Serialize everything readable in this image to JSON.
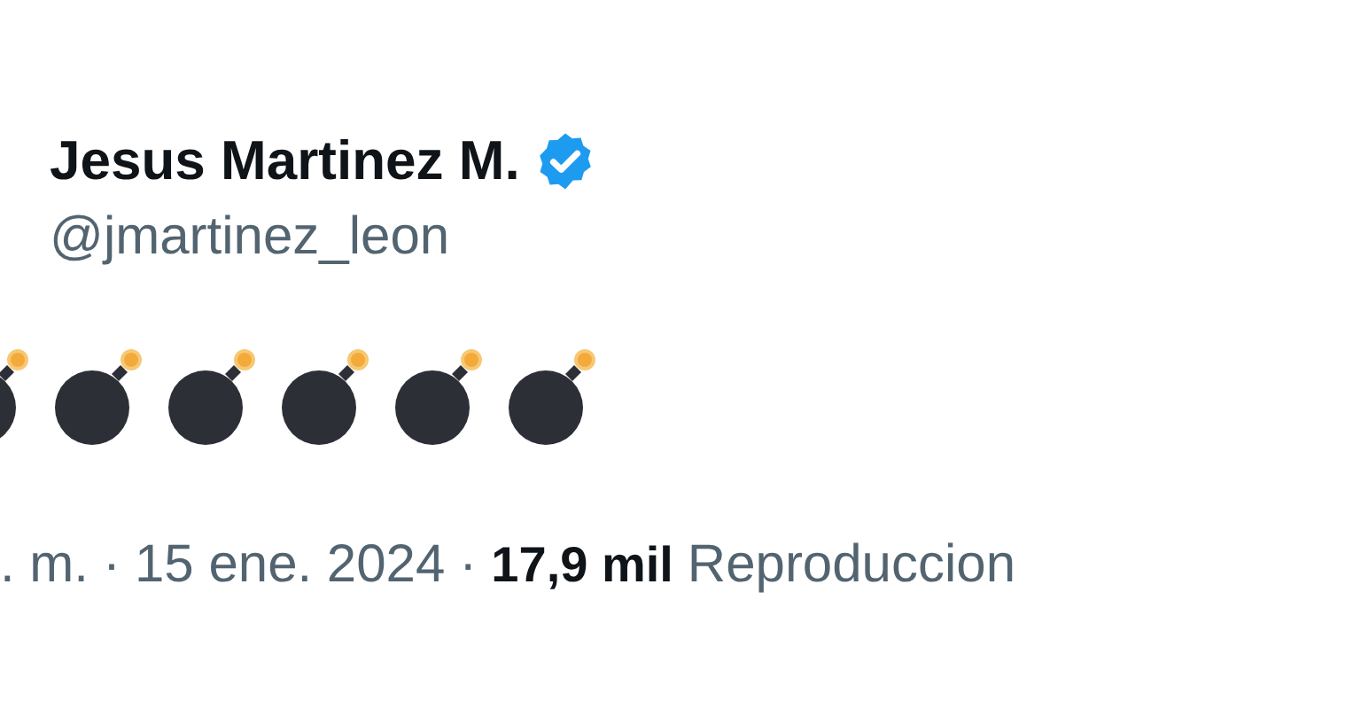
{
  "author": {
    "name": "Jesus Martinez M.",
    "verified": true,
    "handle": "@jmartinez_leon"
  },
  "body": [
    {
      "kind": "bomb",
      "partial": true
    },
    {
      "kind": "bomb",
      "partial": false
    },
    {
      "kind": "bomb",
      "partial": false
    },
    {
      "kind": "bomb",
      "partial": false
    },
    {
      "kind": "bomb",
      "partial": false
    },
    {
      "kind": "bomb",
      "partial": false
    }
  ],
  "meta": {
    "time": ". m.",
    "separator_1": "·",
    "date": "15 ene. 2024",
    "separator_2": "·",
    "views_count": "17,9 mil",
    "views_label": "Reproduccion"
  }
}
